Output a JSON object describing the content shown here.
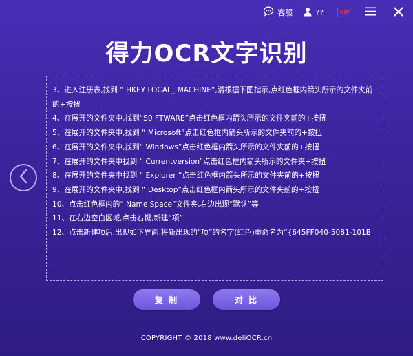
{
  "titlebar": {
    "service_label": "客服",
    "user_label": "??",
    "vip_label": "VIP",
    "icons": [
      "chat-bubble-icon",
      "user-icon",
      "vip-icon",
      "menu-icon",
      "close-icon"
    ]
  },
  "app": {
    "title": "得力OCR文字识别"
  },
  "result": {
    "lines": [
      "3、进入注册表,找到 “ HKEY LOCAL_ MACHINE”,请根据下图指示,点红色框内箭头所示的文件夹前的+按扭",
      "4、在展开的文件夹中,找到“S0 FTWARE”点击红色框内箭头所示的文件夹前的+按扭",
      "5、在展开的文件夹中,找到 “ Microsoft”点击红色框内箭头所示的文件夹前的+按扭",
      "6、在展开的文件夹中,找到“ Windows”点击红色框内箭头所示的文件夹前的+按扭",
      "7、在展开的文件夹中找到 “ Currentversion”点击红色框内箭头所示的文件夹+按扭",
      "8、在展开的文件夹中找到 “ Explorer “点击红色框内箭头所示的文件夹前的+按扭",
      "9、在展开的文件夹中,找到 “ Desktop”点击红色框内箭头所示的文件夹前的+按扭",
      "10、点击红色框内的“ Name Space”文件夹,右边出现“默认”等",
      "11、在右边空白区域,点击右键,新建“项”",
      "12、点击新建项后,出现如下界面,将新出现的“项”的名字(红色)重命名为“{645FF040-5081-101B"
    ]
  },
  "buttons": {
    "copy_label": "复 制",
    "compare_label": "对 比"
  },
  "footer": {
    "copyright": "COPYRIGHT © 2018  www.deliOCR.cn"
  },
  "colors": {
    "background": "#3d249f",
    "accent": "#7b63e6",
    "vip": "#e1353c"
  }
}
